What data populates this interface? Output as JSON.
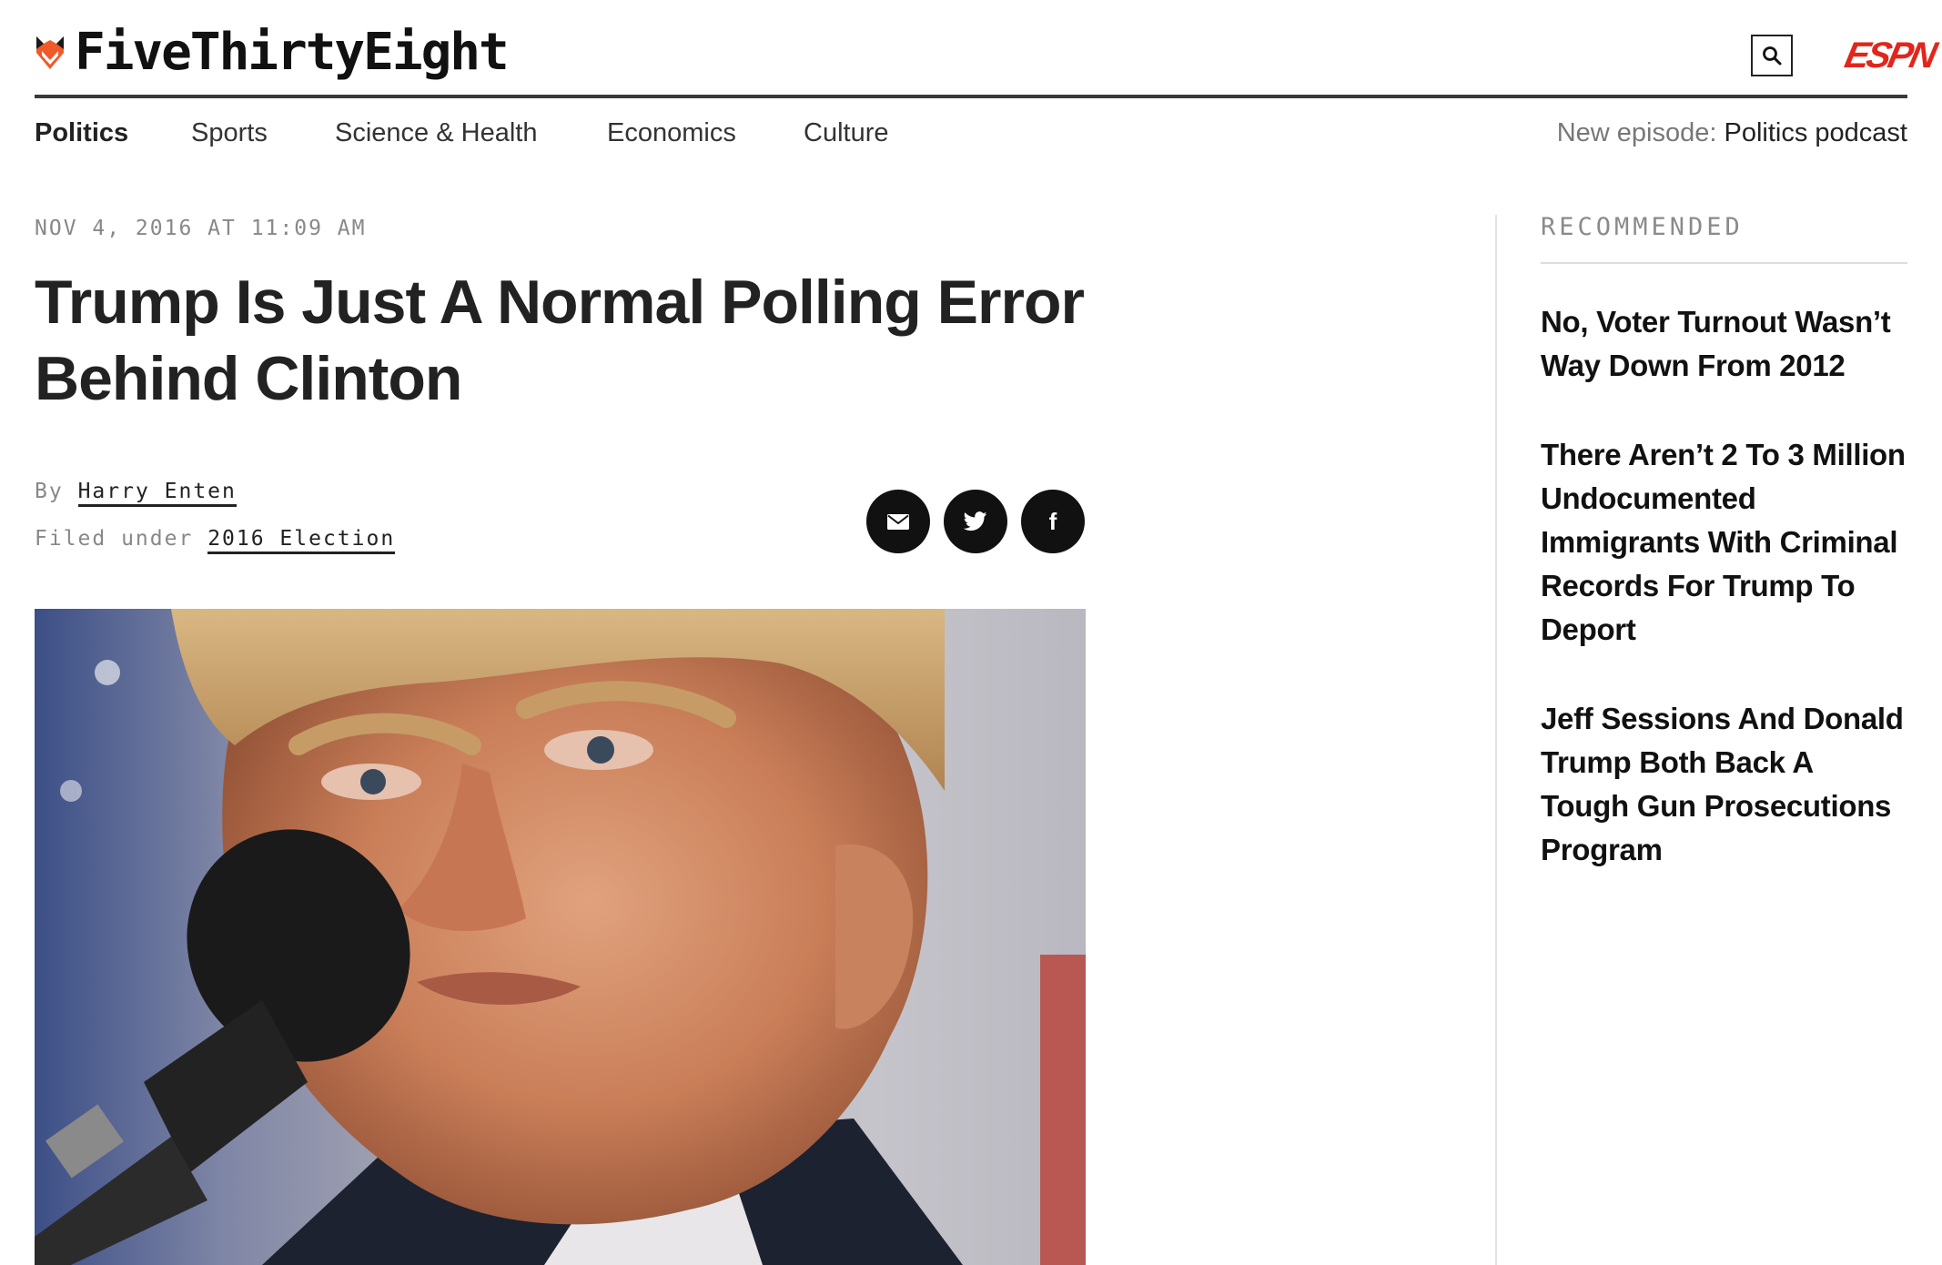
{
  "brand": {
    "name": "FiveThirtyEight",
    "partner": "ESPN",
    "partner_logo_text": "ESPN",
    "accent_color": "#e1261c",
    "logo_mark_color": "#ef5a28"
  },
  "header": {
    "search_icon": "search-icon"
  },
  "nav": {
    "items": [
      {
        "label": "Politics",
        "active": true
      },
      {
        "label": "Sports",
        "active": false
      },
      {
        "label": "Science & Health",
        "active": false
      },
      {
        "label": "Economics",
        "active": false
      },
      {
        "label": "Culture",
        "active": false
      }
    ],
    "podcast_prefix": "New episode:",
    "podcast_title": "Politics podcast"
  },
  "article": {
    "dateline": "NOV 4, 2016 AT 11:09 AM",
    "headline": "Trump Is Just A Normal Polling Error Behind Clinton",
    "byline_prefix": "By",
    "author": "Harry Enten",
    "filed_prefix": "Filed under",
    "filed_tag": "2016 Election",
    "share_icons": [
      "email-icon",
      "twitter-icon",
      "facebook-icon"
    ],
    "facebook_glyph": "f"
  },
  "sidebar": {
    "heading": "RECOMMENDED",
    "items": [
      {
        "title": "No, Voter Turnout Wasn’t Way Down From 2012"
      },
      {
        "title": "There Aren’t 2 To 3 Million Undocumented Immigrants With Criminal Records For Trump To Deport"
      },
      {
        "title": "Jeff Sessions And Donald Trump Both Back A Tough Gun Prosecutions Program"
      }
    ]
  }
}
